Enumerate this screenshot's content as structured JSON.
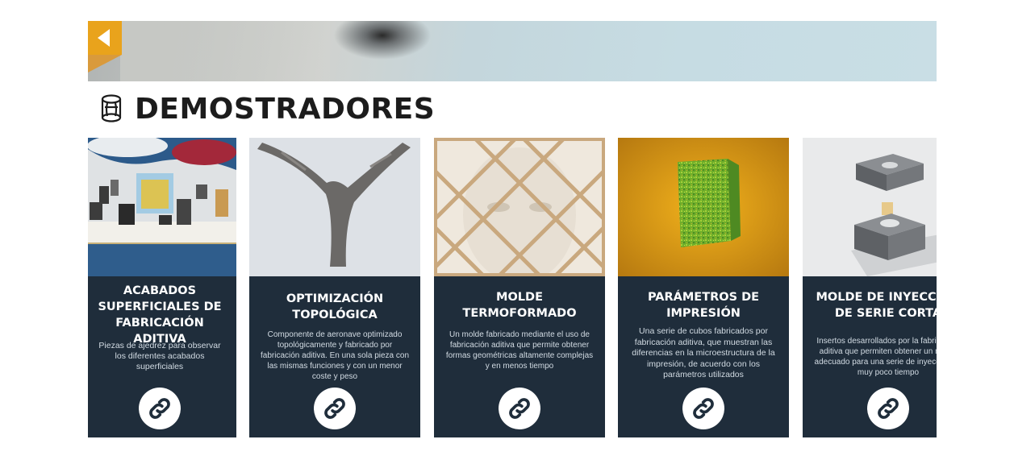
{
  "header": {
    "title": "DEMOSTRADORES"
  },
  "cards": [
    {
      "title": "ACABADOS SUPERFICIALES DE FABRICACIÓN ADITIVA",
      "description": "Piezas de ajedrez para observar los diferentes acabados superficiales",
      "link_icon": "link-icon"
    },
    {
      "title": "OPTIMIZACIÓN TOPOLÓGICA",
      "description": "Componente de aeronave optimizado topológicamente y fabricado por fabricación aditiva. En una sola pieza con las mismas funciones y con un menor coste y peso",
      "link_icon": "link-icon"
    },
    {
      "title": "MOLDE TERMOFORMADO",
      "description": "Un molde fabricado mediante el uso de fabricación aditiva que permite obtener formas geométricas altamente complejas y en menos tiempo",
      "link_icon": "link-icon"
    },
    {
      "title": "PARÁMETROS DE IMPRESIÓN",
      "description": "Una serie de cubos fabricados por fabricación aditiva, que muestran las diferencias en la microestructura de la impresión, de acuerdo con los parámetros utilizados",
      "link_icon": "link-icon"
    },
    {
      "title": "MOLDE DE INYECCIÓN DE SERIE CORTA",
      "description": "Insertos desarrollados por la fabricación aditiva que permiten obtener un molde adecuado para una serie de inyección en muy poco tiempo",
      "link_icon": "link-icon"
    }
  ],
  "colors": {
    "accent": "#e9a31c",
    "card_bg": "#1f2d3b",
    "text_dark": "#1c1c1c"
  }
}
